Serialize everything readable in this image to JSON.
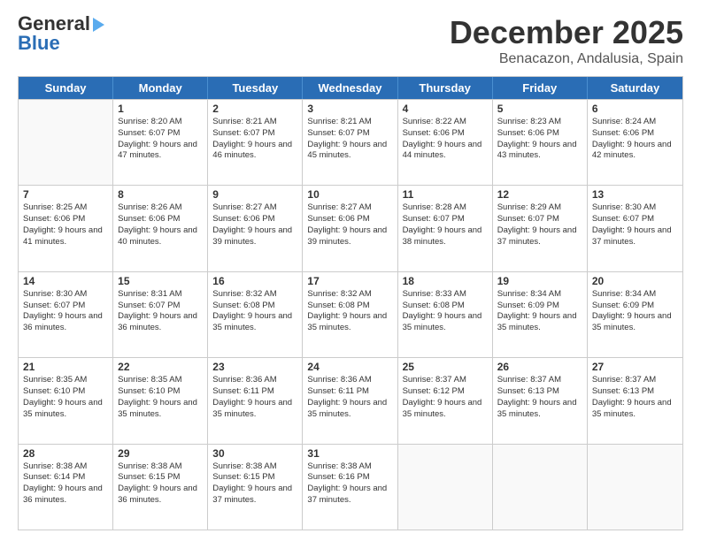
{
  "logo": {
    "line1": "General",
    "line2": "Blue"
  },
  "title": "December 2025",
  "subtitle": "Benacazon, Andalusia, Spain",
  "header_days": [
    "Sunday",
    "Monday",
    "Tuesday",
    "Wednesday",
    "Thursday",
    "Friday",
    "Saturday"
  ],
  "weeks": [
    [
      {
        "day": "",
        "empty": true
      },
      {
        "day": "1",
        "sunrise": "Sunrise: 8:20 AM",
        "sunset": "Sunset: 6:07 PM",
        "daylight": "Daylight: 9 hours and 47 minutes."
      },
      {
        "day": "2",
        "sunrise": "Sunrise: 8:21 AM",
        "sunset": "Sunset: 6:07 PM",
        "daylight": "Daylight: 9 hours and 46 minutes."
      },
      {
        "day": "3",
        "sunrise": "Sunrise: 8:21 AM",
        "sunset": "Sunset: 6:07 PM",
        "daylight": "Daylight: 9 hours and 45 minutes."
      },
      {
        "day": "4",
        "sunrise": "Sunrise: 8:22 AM",
        "sunset": "Sunset: 6:06 PM",
        "daylight": "Daylight: 9 hours and 44 minutes."
      },
      {
        "day": "5",
        "sunrise": "Sunrise: 8:23 AM",
        "sunset": "Sunset: 6:06 PM",
        "daylight": "Daylight: 9 hours and 43 minutes."
      },
      {
        "day": "6",
        "sunrise": "Sunrise: 8:24 AM",
        "sunset": "Sunset: 6:06 PM",
        "daylight": "Daylight: 9 hours and 42 minutes."
      }
    ],
    [
      {
        "day": "7",
        "sunrise": "Sunrise: 8:25 AM",
        "sunset": "Sunset: 6:06 PM",
        "daylight": "Daylight: 9 hours and 41 minutes."
      },
      {
        "day": "8",
        "sunrise": "Sunrise: 8:26 AM",
        "sunset": "Sunset: 6:06 PM",
        "daylight": "Daylight: 9 hours and 40 minutes."
      },
      {
        "day": "9",
        "sunrise": "Sunrise: 8:27 AM",
        "sunset": "Sunset: 6:06 PM",
        "daylight": "Daylight: 9 hours and 39 minutes."
      },
      {
        "day": "10",
        "sunrise": "Sunrise: 8:27 AM",
        "sunset": "Sunset: 6:06 PM",
        "daylight": "Daylight: 9 hours and 39 minutes."
      },
      {
        "day": "11",
        "sunrise": "Sunrise: 8:28 AM",
        "sunset": "Sunset: 6:07 PM",
        "daylight": "Daylight: 9 hours and 38 minutes."
      },
      {
        "day": "12",
        "sunrise": "Sunrise: 8:29 AM",
        "sunset": "Sunset: 6:07 PM",
        "daylight": "Daylight: 9 hours and 37 minutes."
      },
      {
        "day": "13",
        "sunrise": "Sunrise: 8:30 AM",
        "sunset": "Sunset: 6:07 PM",
        "daylight": "Daylight: 9 hours and 37 minutes."
      }
    ],
    [
      {
        "day": "14",
        "sunrise": "Sunrise: 8:30 AM",
        "sunset": "Sunset: 6:07 PM",
        "daylight": "Daylight: 9 hours and 36 minutes."
      },
      {
        "day": "15",
        "sunrise": "Sunrise: 8:31 AM",
        "sunset": "Sunset: 6:07 PM",
        "daylight": "Daylight: 9 hours and 36 minutes."
      },
      {
        "day": "16",
        "sunrise": "Sunrise: 8:32 AM",
        "sunset": "Sunset: 6:08 PM",
        "daylight": "Daylight: 9 hours and 35 minutes."
      },
      {
        "day": "17",
        "sunrise": "Sunrise: 8:32 AM",
        "sunset": "Sunset: 6:08 PM",
        "daylight": "Daylight: 9 hours and 35 minutes."
      },
      {
        "day": "18",
        "sunrise": "Sunrise: 8:33 AM",
        "sunset": "Sunset: 6:08 PM",
        "daylight": "Daylight: 9 hours and 35 minutes."
      },
      {
        "day": "19",
        "sunrise": "Sunrise: 8:34 AM",
        "sunset": "Sunset: 6:09 PM",
        "daylight": "Daylight: 9 hours and 35 minutes."
      },
      {
        "day": "20",
        "sunrise": "Sunrise: 8:34 AM",
        "sunset": "Sunset: 6:09 PM",
        "daylight": "Daylight: 9 hours and 35 minutes."
      }
    ],
    [
      {
        "day": "21",
        "sunrise": "Sunrise: 8:35 AM",
        "sunset": "Sunset: 6:10 PM",
        "daylight": "Daylight: 9 hours and 35 minutes."
      },
      {
        "day": "22",
        "sunrise": "Sunrise: 8:35 AM",
        "sunset": "Sunset: 6:10 PM",
        "daylight": "Daylight: 9 hours and 35 minutes."
      },
      {
        "day": "23",
        "sunrise": "Sunrise: 8:36 AM",
        "sunset": "Sunset: 6:11 PM",
        "daylight": "Daylight: 9 hours and 35 minutes."
      },
      {
        "day": "24",
        "sunrise": "Sunrise: 8:36 AM",
        "sunset": "Sunset: 6:11 PM",
        "daylight": "Daylight: 9 hours and 35 minutes."
      },
      {
        "day": "25",
        "sunrise": "Sunrise: 8:37 AM",
        "sunset": "Sunset: 6:12 PM",
        "daylight": "Daylight: 9 hours and 35 minutes."
      },
      {
        "day": "26",
        "sunrise": "Sunrise: 8:37 AM",
        "sunset": "Sunset: 6:13 PM",
        "daylight": "Daylight: 9 hours and 35 minutes."
      },
      {
        "day": "27",
        "sunrise": "Sunrise: 8:37 AM",
        "sunset": "Sunset: 6:13 PM",
        "daylight": "Daylight: 9 hours and 35 minutes."
      }
    ],
    [
      {
        "day": "28",
        "sunrise": "Sunrise: 8:38 AM",
        "sunset": "Sunset: 6:14 PM",
        "daylight": "Daylight: 9 hours and 36 minutes."
      },
      {
        "day": "29",
        "sunrise": "Sunrise: 8:38 AM",
        "sunset": "Sunset: 6:15 PM",
        "daylight": "Daylight: 9 hours and 36 minutes."
      },
      {
        "day": "30",
        "sunrise": "Sunrise: 8:38 AM",
        "sunset": "Sunset: 6:15 PM",
        "daylight": "Daylight: 9 hours and 37 minutes."
      },
      {
        "day": "31",
        "sunrise": "Sunrise: 8:38 AM",
        "sunset": "Sunset: 6:16 PM",
        "daylight": "Daylight: 9 hours and 37 minutes."
      },
      {
        "day": "",
        "empty": true
      },
      {
        "day": "",
        "empty": true
      },
      {
        "day": "",
        "empty": true
      }
    ]
  ]
}
